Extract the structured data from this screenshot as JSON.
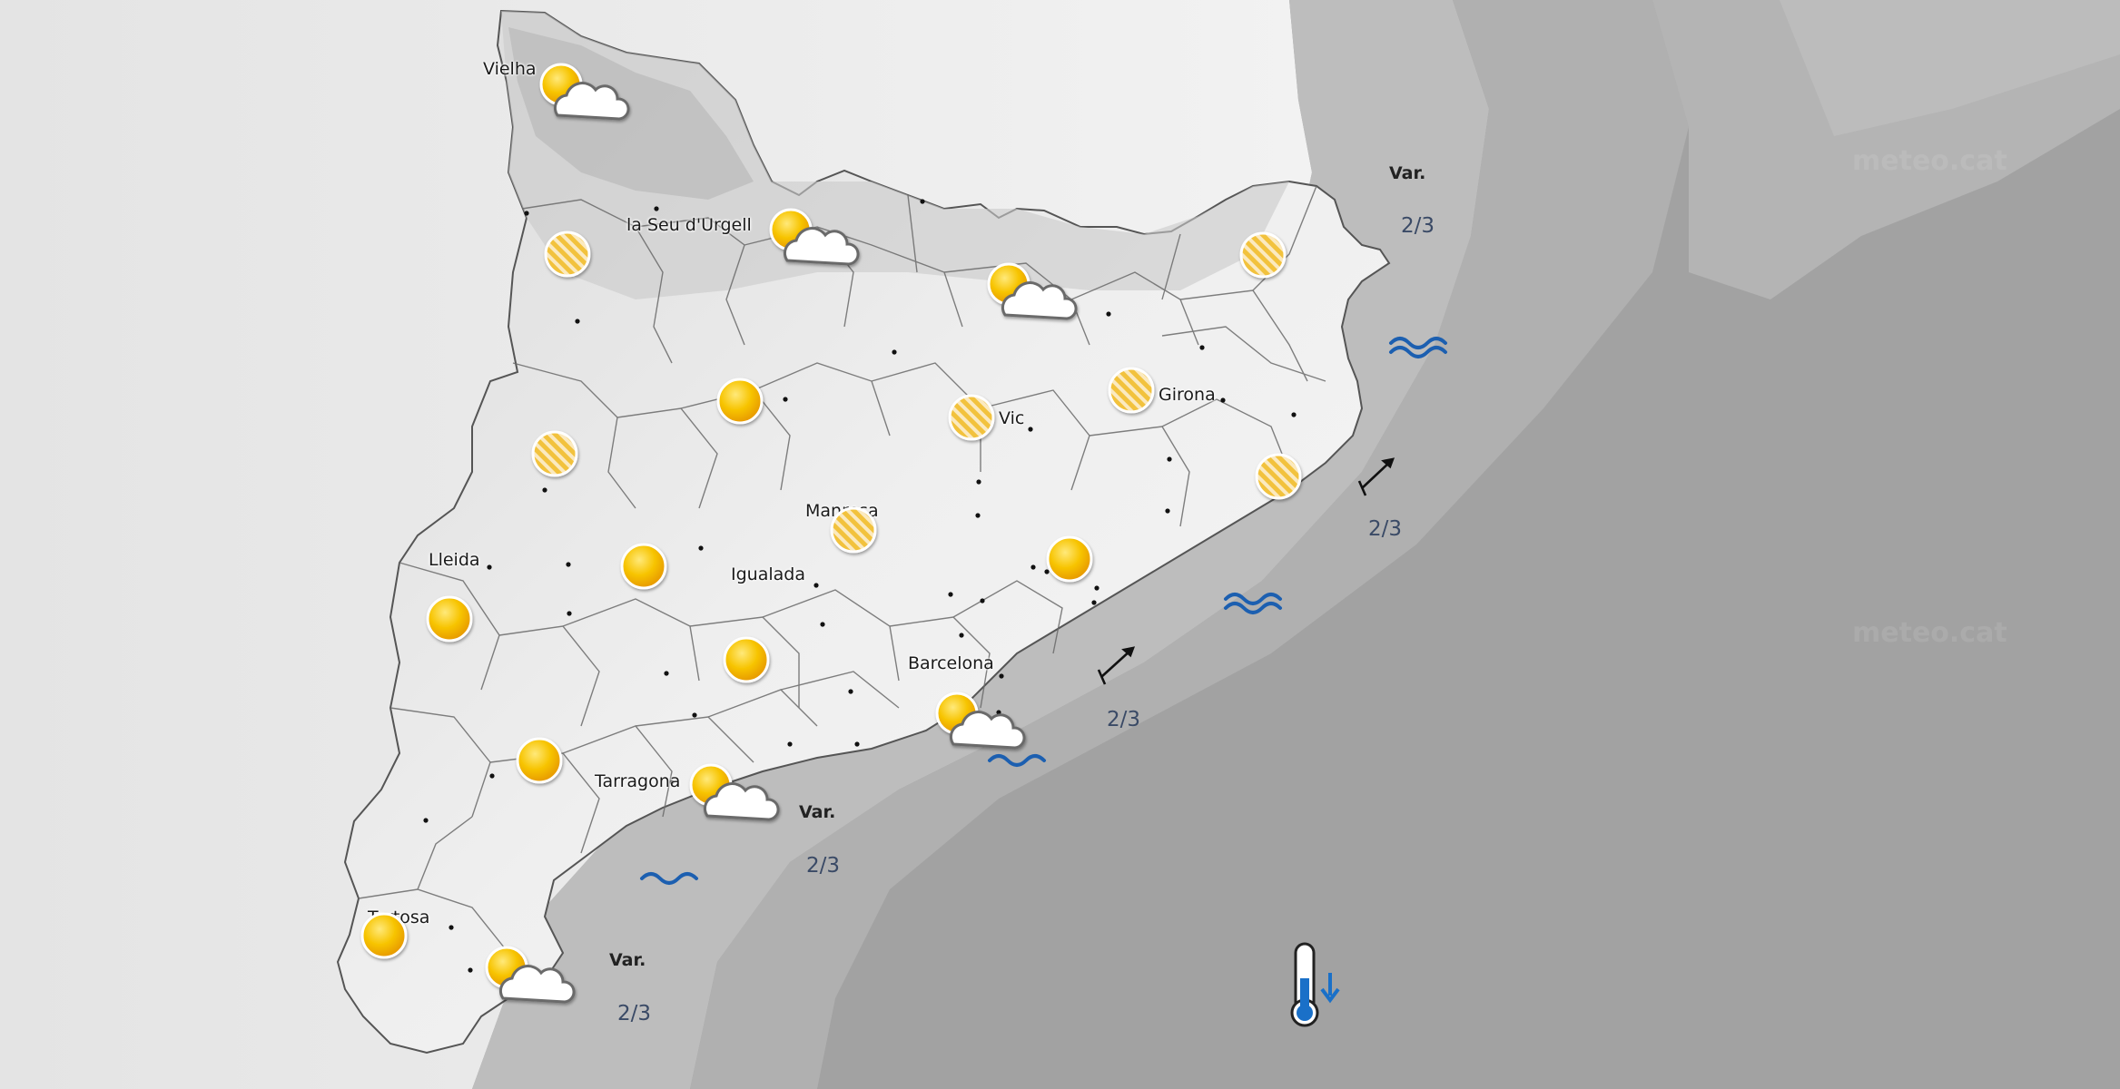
{
  "cities": [
    {
      "id": "vielha",
      "name": "Vielha"
    },
    {
      "id": "seu",
      "name": "la Seu d'Urgell"
    },
    {
      "id": "vic",
      "name": "Vic"
    },
    {
      "id": "girona",
      "name": "Girona"
    },
    {
      "id": "lleida",
      "name": "Lleida"
    },
    {
      "id": "manresa",
      "name": "Manresa"
    },
    {
      "id": "igualada",
      "name": "Igualada"
    },
    {
      "id": "barcelona",
      "name": "Barcelona"
    },
    {
      "id": "tarragona",
      "name": "Tarragona"
    },
    {
      "id": "tortosa",
      "name": "Tortosa"
    }
  ],
  "weather_icons": [
    {
      "type": "sun-cloud",
      "near": "Vielha"
    },
    {
      "type": "sun-cloud",
      "near": "la Seu d'Urgell"
    },
    {
      "type": "sun-cloud",
      "near": "Berguedà"
    },
    {
      "type": "sun-cloud",
      "near": "Barcelona"
    },
    {
      "type": "sun-cloud",
      "near": "Tarragona"
    },
    {
      "type": "sun-cloud",
      "near": "Delta de l'Ebre"
    },
    {
      "type": "hazy-sun",
      "near": "Pallars"
    },
    {
      "type": "hazy-sun",
      "near": "Noguera"
    },
    {
      "type": "hazy-sun",
      "near": "Vic"
    },
    {
      "type": "hazy-sun",
      "near": "Girona"
    },
    {
      "type": "hazy-sun",
      "near": "Empordà"
    },
    {
      "type": "hazy-sun",
      "near": "Maresme"
    },
    {
      "type": "hazy-sun",
      "near": "Manresa"
    },
    {
      "type": "sun",
      "near": "Solsonès"
    },
    {
      "type": "sun",
      "near": "Urgell"
    },
    {
      "type": "sun",
      "near": "Lleida"
    },
    {
      "type": "sun",
      "near": "Anoia"
    },
    {
      "type": "sun",
      "near": "Vallès"
    },
    {
      "type": "sun",
      "near": "Priorat"
    },
    {
      "type": "sun",
      "near": "Tortosa"
    }
  ],
  "marine": {
    "north": {
      "wind": "Var.",
      "waves": "2/3"
    },
    "costa_brava": {
      "waves": "2/3"
    },
    "central": {
      "waves": "2/3"
    },
    "tarragona": {
      "wind": "Var.",
      "waves": "2/3"
    },
    "ebre": {
      "wind": "Var.",
      "waves": "2/3"
    }
  },
  "temperature_trend": "falling",
  "watermark": [
    "meteo.cat",
    "meteo.cat"
  ],
  "colors": {
    "sun": "#f5b800",
    "wave": "#1c5fb0",
    "thermo": "#1a70c8",
    "sea": "#9e9e9e"
  }
}
